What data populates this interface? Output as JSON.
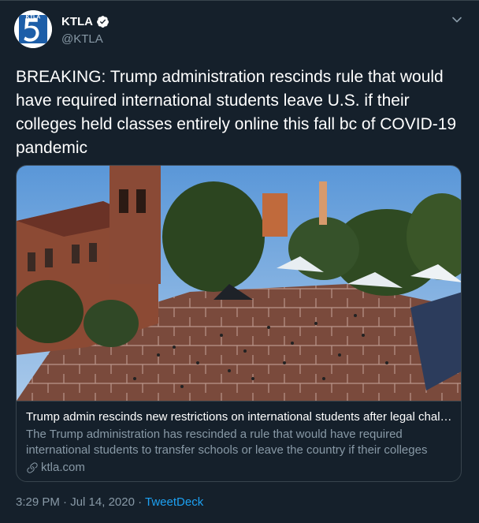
{
  "account": {
    "name": "KTLA",
    "handle": "@KTLA",
    "avatar_text": "KTLA",
    "avatar_number": "5"
  },
  "tweet": {
    "text": "BREAKING: Trump administration rescinds rule that would have required international students leave U.S. if their colleges held classes entirely online this fall bc of COVID-19 pandemic"
  },
  "card": {
    "title": "Trump admin rescinds new restrictions on international students after legal challe...",
    "description": "The Trump administration has rescinded a rule that would have required international students to transfer schools or leave the country if their colleges hol...",
    "domain": "ktla.com"
  },
  "meta": {
    "time": "3:29 PM",
    "separator": " · ",
    "date": "Jul 14, 2020",
    "source": "TweetDeck"
  },
  "colors": {
    "background": "#15202b",
    "border": "#38444d",
    "secondary_text": "#8899a6",
    "link": "#1da1f2",
    "verified": "#ffffff"
  },
  "icons": [
    "verified-icon",
    "chevron-down-icon",
    "link-icon"
  ]
}
